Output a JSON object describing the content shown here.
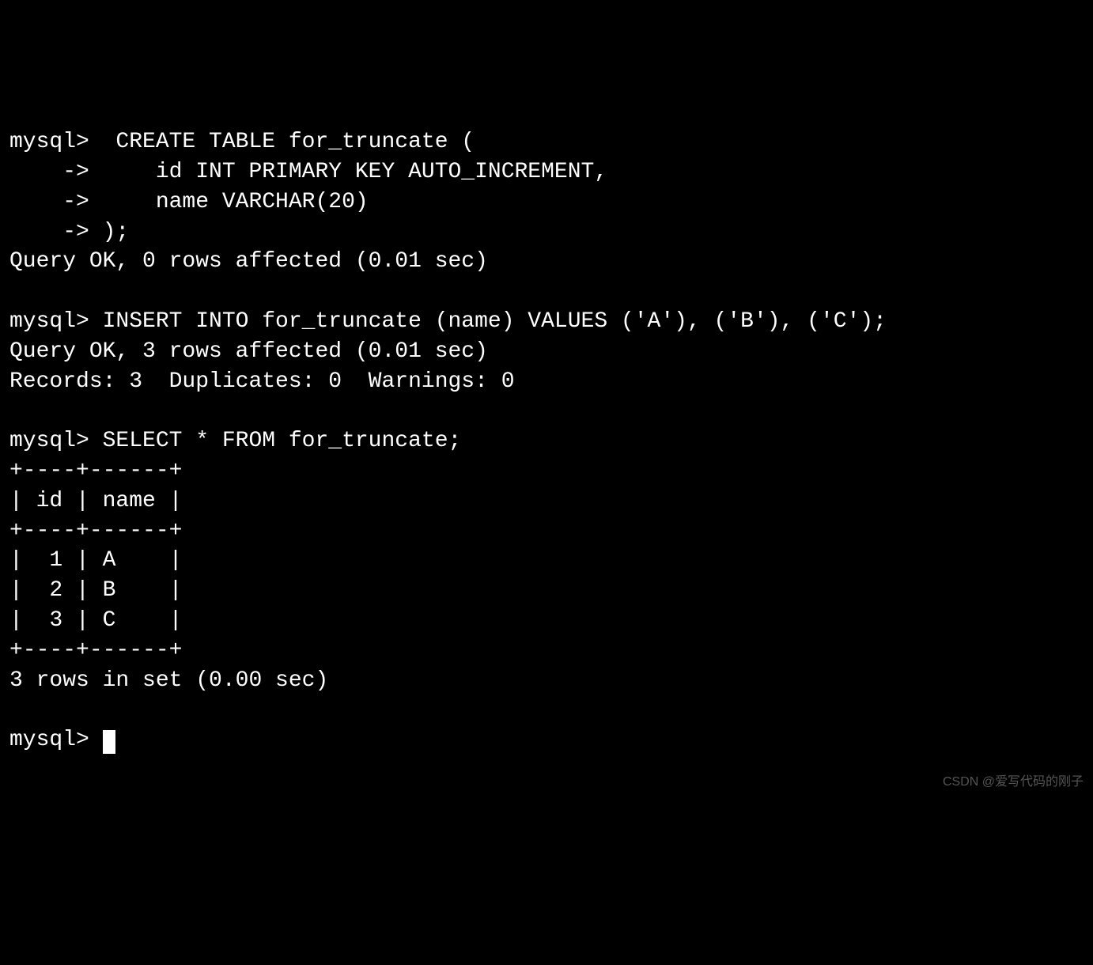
{
  "terminal": {
    "lines": [
      "mysql>  CREATE TABLE for_truncate (",
      "    ->     id INT PRIMARY KEY AUTO_INCREMENT,",
      "    ->     name VARCHAR(20)",
      "    -> );",
      "Query OK, 0 rows affected (0.01 sec)",
      "",
      "mysql> INSERT INTO for_truncate (name) VALUES ('A'), ('B'), ('C');",
      "Query OK, 3 rows affected (0.01 sec)",
      "Records: 3  Duplicates: 0  Warnings: 0",
      "",
      "mysql> SELECT * FROM for_truncate;",
      "+----+------+",
      "| id | name |",
      "+----+------+",
      "|  1 | A    |",
      "|  2 | B    |",
      "|  3 | C    |",
      "+----+------+",
      "3 rows in set (0.00 sec)",
      "",
      "mysql> "
    ],
    "prompt": "mysql> ",
    "continuation": "    -> ",
    "commands": {
      "create_table": "CREATE TABLE for_truncate (\n    id INT PRIMARY KEY AUTO_INCREMENT,\n    name VARCHAR(20)\n);",
      "insert": "INSERT INTO for_truncate (name) VALUES ('A'), ('B'), ('C');",
      "select": "SELECT * FROM for_truncate;"
    },
    "results": {
      "create_response": "Query OK, 0 rows affected (0.01 sec)",
      "insert_response": "Query OK, 3 rows affected (0.01 sec)",
      "insert_summary": "Records: 3  Duplicates: 0  Warnings: 0",
      "select_table": {
        "columns": [
          "id",
          "name"
        ],
        "rows": [
          [
            1,
            "A"
          ],
          [
            2,
            "B"
          ],
          [
            3,
            "C"
          ]
        ]
      },
      "select_footer": "3 rows in set (0.00 sec)"
    }
  },
  "watermark": "CSDN @爱写代码的刚子"
}
